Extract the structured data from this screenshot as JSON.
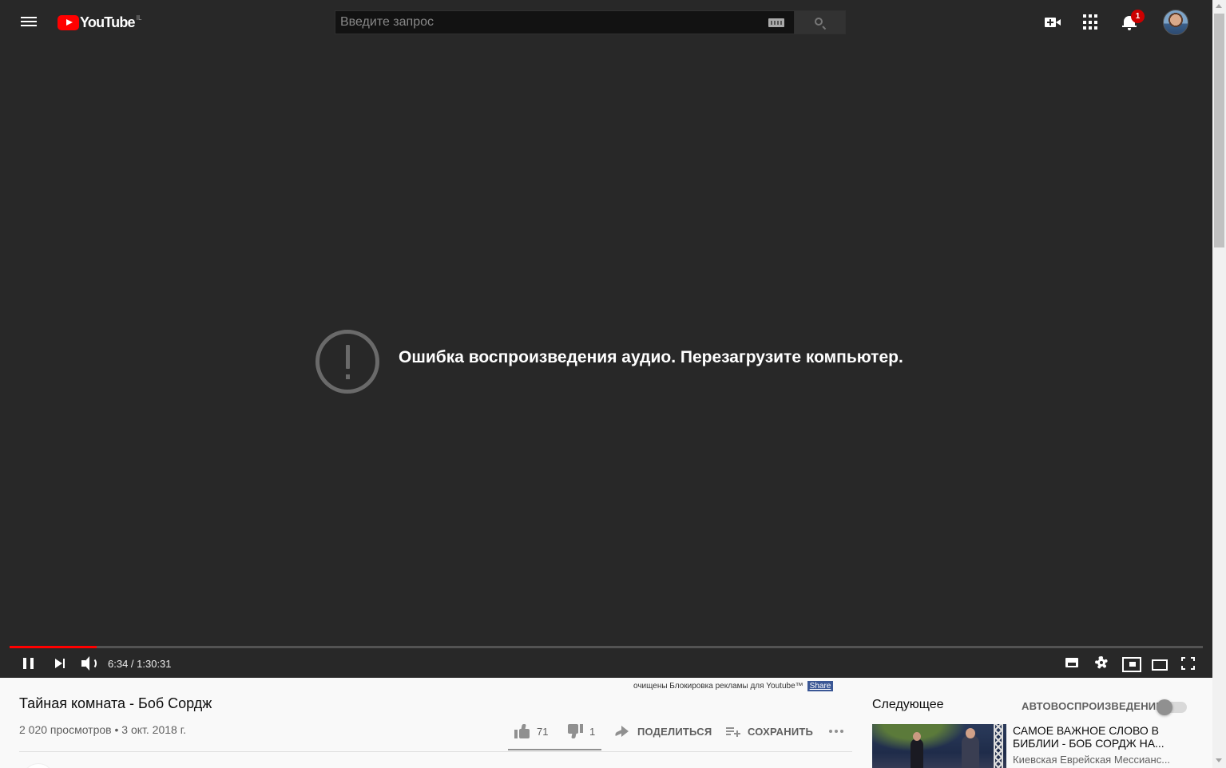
{
  "header": {
    "logo_text": "YouTube",
    "logo_country": "IL",
    "search_placeholder": "Введите запрос",
    "notification_count": "1",
    "icons": [
      "menu-icon",
      "youtube-logo",
      "keyboard-icon",
      "search-icon",
      "create-video-icon",
      "apps-grid-icon",
      "bell-icon",
      "avatar"
    ]
  },
  "player": {
    "error_message": "Ошибка воспроизведения аудио. Перезагрузите компьютер.",
    "time_display": "6:34 / 1:30:31",
    "progress_fraction": 0.0727,
    "progress_color": "#ff0000",
    "icons": [
      "pause-icon",
      "next-icon",
      "volume-icon",
      "subtitles-icon",
      "settings-icon",
      "miniplayer-icon",
      "theater-icon",
      "fullscreen-icon"
    ]
  },
  "adblock_notice": {
    "text": "очищены Блокировка рекламы для Youtube™",
    "share_label": "Share"
  },
  "video": {
    "title": "Тайная комната - Боб Сордж",
    "meta": "2 020 просмотров • 3 окт. 2018 г.",
    "likes": "71",
    "dislikes": "1",
    "share_label": "ПОДЕЛИТЬСЯ",
    "save_label": "СОХРАНИТЬ"
  },
  "sidebar": {
    "next_heading": "Следующее",
    "autoplay_label": "АВТОВОСПРОИЗВЕДЕНИЕ",
    "autoplay_on": false,
    "items": [
      {
        "title": "САМОЕ ВАЖНОЕ СЛОВО В БИБЛИИ - БОБ СОРДЖ НА...",
        "channel": "Киевская Еврейская Мессианс..."
      }
    ]
  },
  "colors": {
    "masthead_bg": "#282828",
    "player_bg": "#282828",
    "page_bg": "#f9f9f9",
    "brand_red": "#ff0000",
    "badge_red": "#cc0000"
  }
}
